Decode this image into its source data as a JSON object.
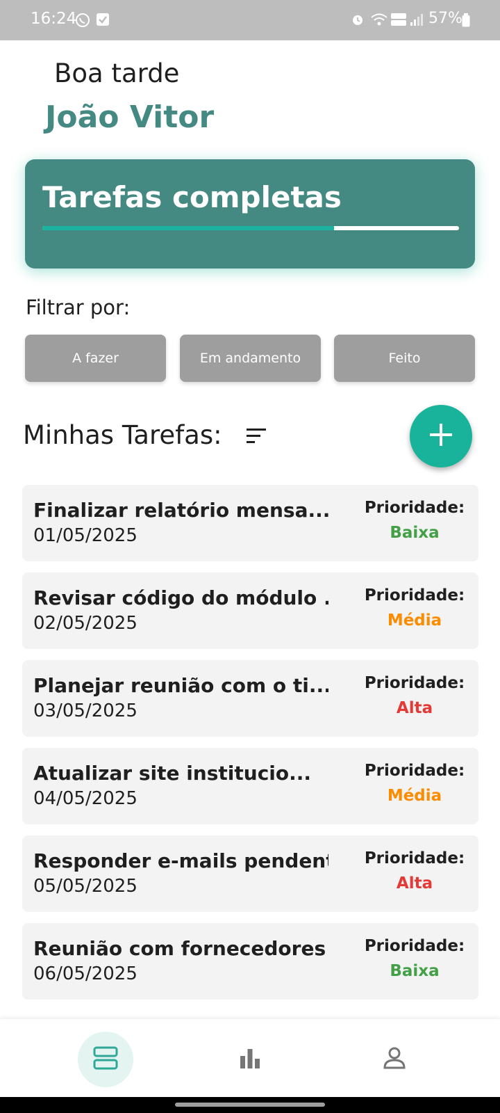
{
  "status_bar": {
    "time": "16:24",
    "battery": "57%",
    "icons": [
      "whatsapp-icon",
      "check-square-icon",
      "alarm-icon",
      "wifi-icon",
      "volte-icon",
      "signal-icon",
      "battery-icon"
    ]
  },
  "header": {
    "greeting": "Boa tarde",
    "user_name": "João Vitor"
  },
  "progress_card": {
    "title": "Tarefas completas",
    "progress_fraction": 0.7,
    "fill_color": "#19b3a0",
    "card_color": "#458a82"
  },
  "filter": {
    "label": "Filtrar por:",
    "options": [
      "A fazer",
      "Em andamento",
      "Feito"
    ]
  },
  "tasks_section": {
    "title": "Minhas Tarefas:",
    "sort_icon": "sort-icon",
    "add_icon": "plus-icon"
  },
  "tasks": [
    {
      "title": "Finalizar relatório mensa...",
      "date": "01/05/2025",
      "priority_label": "Prioridade:",
      "priority": "Baixa",
      "priority_color": "#43a047"
    },
    {
      "title": "Revisar código do módulo ...",
      "date": "02/05/2025",
      "priority_label": "Prioridade:",
      "priority": "Média",
      "priority_color": "#fb8c00"
    },
    {
      "title": "Planejar reunião com o ti...",
      "date": "03/05/2025",
      "priority_label": "Prioridade:",
      "priority": "Alta",
      "priority_color": "#e53935"
    },
    {
      "title": "Atualizar site institucio...",
      "date": "04/05/2025",
      "priority_label": "Prioridade:",
      "priority": "Média",
      "priority_color": "#fb8c00"
    },
    {
      "title": "Responder e-mails pendent...",
      "date": "05/05/2025",
      "priority_label": "Prioridade:",
      "priority": "Alta",
      "priority_color": "#e53935"
    },
    {
      "title": "Reunião com fornecedores",
      "date": "06/05/2025",
      "priority_label": "Prioridade:",
      "priority": "Baixa",
      "priority_color": "#43a047"
    }
  ],
  "bottom_nav": {
    "items": [
      "tasks-icon",
      "chart-icon",
      "profile-icon"
    ],
    "active_index": 0
  }
}
